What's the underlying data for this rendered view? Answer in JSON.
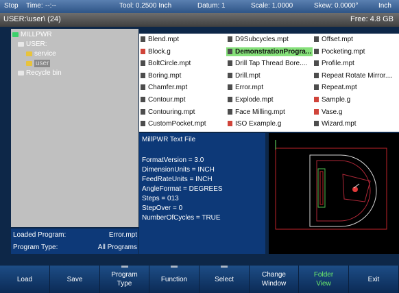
{
  "status": {
    "mode": "Stop",
    "time_label": "Time:",
    "time_value": "--:--",
    "tool": "Tool: 0.2500 Inch",
    "datum": "Datum: 1",
    "scale": "Scale: 1.0000",
    "skew": "Skew: 0.0000°",
    "units": "Inch"
  },
  "pathbar": {
    "path": "USER:\\user\\ (24)",
    "free": "Free: 4.8 GB"
  },
  "tree": [
    {
      "label": "MILLPWR",
      "color": "#3bd06a"
    },
    {
      "label": "USER:",
      "color": "#e8e8e8"
    },
    {
      "label": "service",
      "color": "#e8c33c"
    },
    {
      "label": "user",
      "color": "#e8c33c"
    },
    {
      "label": "Recycle bin",
      "color": "#e8e8e8"
    }
  ],
  "files": [
    {
      "name": "Blend.mpt",
      "type": "m"
    },
    {
      "name": "Block.g",
      "type": "g"
    },
    {
      "name": "BoltCircle.mpt",
      "type": "m"
    },
    {
      "name": "Boring.mpt",
      "type": "m"
    },
    {
      "name": "Chamfer.mpt",
      "type": "m"
    },
    {
      "name": "Contour.mpt",
      "type": "m"
    },
    {
      "name": "Contouring.mpt",
      "type": "m"
    },
    {
      "name": "CustomPocket.mpt",
      "type": "m"
    },
    {
      "name": "D9Subcycles.mpt",
      "type": "m"
    },
    {
      "name": "DemonstrationProgra...",
      "type": "m",
      "selected": true
    },
    {
      "name": "Drill Tap Thread Bore....",
      "type": "m"
    },
    {
      "name": "Drill.mpt",
      "type": "m"
    },
    {
      "name": "Error.mpt",
      "type": "m"
    },
    {
      "name": "Explode.mpt",
      "type": "m"
    },
    {
      "name": "Face Milling.mpt",
      "type": "m"
    },
    {
      "name": "ISO Example.g",
      "type": "g"
    },
    {
      "name": "Offset.mpt",
      "type": "m"
    },
    {
      "name": "Pocketing.mpt",
      "type": "m"
    },
    {
      "name": "Profile.mpt",
      "type": "m"
    },
    {
      "name": "Repeat Rotate Mirror....",
      "type": "m"
    },
    {
      "name": "Repeat.mpt",
      "type": "m"
    },
    {
      "name": "Sample.g",
      "type": "g"
    },
    {
      "name": "Vase.g",
      "type": "g"
    },
    {
      "name": "Wizard.mpt",
      "type": "m"
    }
  ],
  "info": {
    "title": "MillPWR Text File",
    "lines": [
      "FormatVersion = 3.0",
      "DimensionUnits = INCH",
      "FeedRateUnits = INCH",
      "AngleFormat = DEGREES",
      "Steps = 013",
      "StepOver = 0",
      "NumberOfCycles = TRUE"
    ]
  },
  "loaded": {
    "program_label": "Loaded Program:",
    "program_value": "Error.mpt",
    "type_label": "Program Type:",
    "type_value": "All Programs"
  },
  "softkeys": [
    {
      "label": "Load",
      "line2": ""
    },
    {
      "label": "Save",
      "line2": ""
    },
    {
      "label": "Program",
      "line2": "Type",
      "tab": true
    },
    {
      "label": "Function",
      "line2": "",
      "tab": true
    },
    {
      "label": "Select",
      "line2": "",
      "tab": true
    },
    {
      "label": "Change",
      "line2": "Window"
    },
    {
      "label": "Folder",
      "line2": "View",
      "active": true
    },
    {
      "label": "Exit",
      "line2": ""
    }
  ],
  "colors": {
    "accent_green": "#6ef06a",
    "panel_blue": "#0d3978",
    "selection": "#86e07a"
  }
}
